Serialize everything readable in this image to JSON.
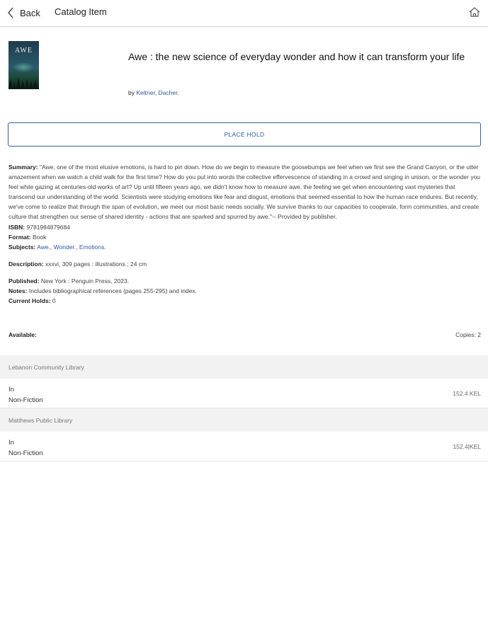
{
  "header": {
    "back_label": "Back",
    "title": "Catalog Item"
  },
  "icons": {
    "back": "chevron-left-icon",
    "home": "home-icon"
  },
  "item": {
    "cover_text": "AWE",
    "title": "Awe : the new science of everyday wonder and how it can transform your life",
    "by_label": "by",
    "author": "Keltner, Dacher."
  },
  "place_hold_label": "PLACE HOLD",
  "details": {
    "summary_label": "Summary:",
    "summary": "\"Awe, one of the most elusive emotions, is hard to pin down. How do we begin to measure the goosebumps we feel when we first see the Grand Canyon, or the utter amazement when we watch a child walk for the first time? How do you put into words the collective effervescence of standing in a crowd and singing in unison, or the wonder you feel while gazing at centuries-old works of art? Up until fifteen years ago, we didn't know how to measure awe, the feeling we get when encountering vast mysteries that transcend our understanding of the world. Scientists were studying emotions like fear and disgust, emotions that seemed essential to how the human race endures. But recently, we've come to realize that through the span of evolution, we meet our most basic needs socially. We survive thanks to our capacities to cooperate, form communities, and create culture that strengthen our sense of shared identity - actions that are sparked and spurred by awe.\"-- Provided by publisher.",
    "isbn_label": "ISBN:",
    "isbn": "9781984879684",
    "format_label": "Format:",
    "format": "Book",
    "subjects_label": "Subjects:",
    "subjects": [
      "Awe.",
      "Wonder.",
      "Emotions."
    ],
    "description_label": "Description:",
    "description": "xxxvi, 309 pages : illustrations ; 24 cm",
    "published_label": "Published:",
    "published": "New York : Penguin Press, 2023.",
    "notes_label": "Notes:",
    "notes": "Includes bibliographical references (pages 255-295) and index.",
    "holds_label": "Current Holds:",
    "holds": "0"
  },
  "availability": {
    "label": "Available:",
    "copies": "Copies: 2",
    "libraries": [
      {
        "name": "Lebanon Community Library",
        "status": "In",
        "collection": "Non-Fiction",
        "call_number": "152.4 KEL"
      },
      {
        "name": "Matthews Public Library",
        "status": "In",
        "collection": "Non-Fiction",
        "call_number": "152.4|KEL"
      }
    ]
  },
  "colors": {
    "link": "#2f56a6",
    "section_bg": "#f2f2f2"
  }
}
